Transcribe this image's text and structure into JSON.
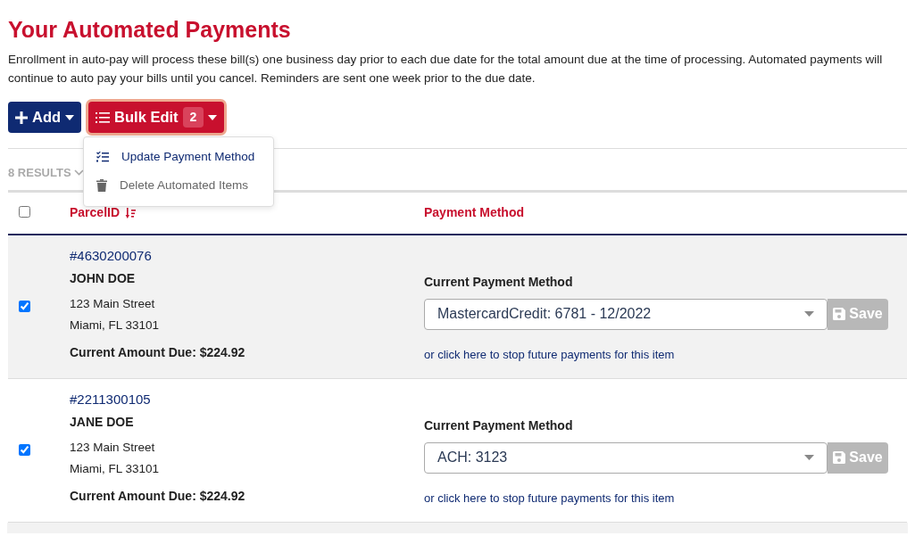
{
  "title": "Your Automated Payments",
  "intro": "Enrollment in auto-pay will process these bill(s) one business day prior to each due date for the total amount due at the time of processing. Automated payments will continue to auto pay your bills until you cancel. Reminders are sent one week prior to the due date.",
  "toolbar": {
    "add_label": "Add",
    "bulk_label": "Bulk Edit",
    "bulk_count": "2",
    "menu_expanded": true,
    "menu": [
      {
        "kind": "update",
        "label": "Update Payment Method",
        "disabled": false
      },
      {
        "kind": "delete",
        "label": "Delete Automated Items",
        "disabled": true
      }
    ]
  },
  "results": "8 RESULTS",
  "table": {
    "select_all": {
      "checked": false
    },
    "columns": [
      "ParcelID",
      "Payment Method"
    ],
    "rows": [
      {
        "checked": true,
        "parcel": "#4630200076",
        "name": "JOHN DOE",
        "address": [
          "123 Main Street",
          "Miami, FL 33101"
        ],
        "amount": "Current Amount Due: $224.92",
        "method_label": "Current Payment Method",
        "method": "MastercardCredit: 6781 - 12/2022",
        "save": "Save",
        "save_disabled": true,
        "stop_link": "or click here to stop future payments for this item"
      },
      {
        "checked": true,
        "parcel": "#2211300105",
        "name": "JANE DOE",
        "address": [
          "123 Main Street",
          "Miami, FL 33101"
        ],
        "amount": "Current Amount Due: $224.92",
        "method_label": "Current Payment Method",
        "method": "ACH: 3123",
        "save": "Save",
        "save_disabled": true,
        "stop_link": "or click here to stop future payments for this item"
      }
    ]
  }
}
